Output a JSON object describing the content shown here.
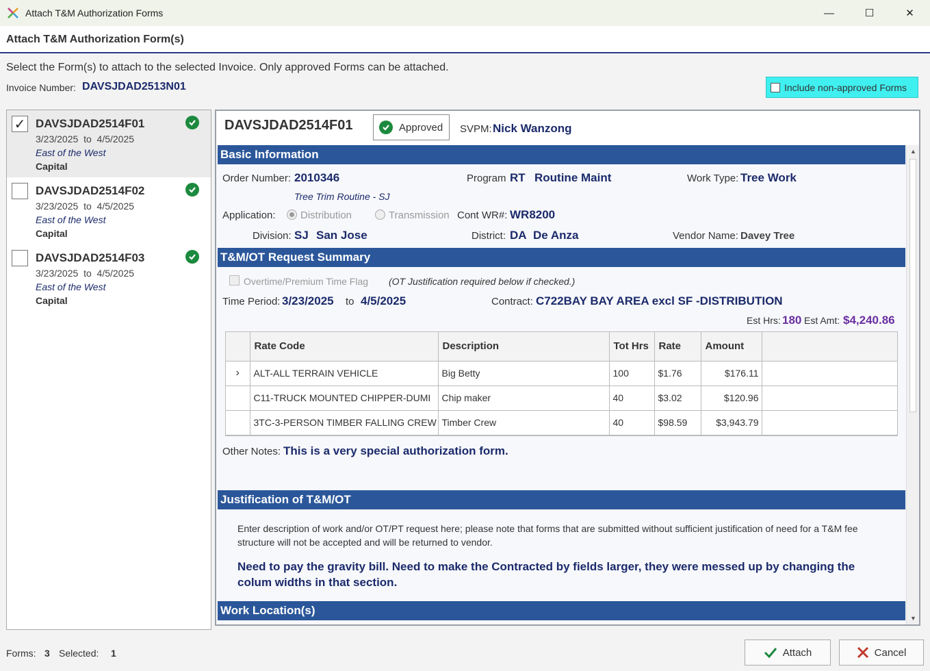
{
  "window": {
    "title": "Attach T&M Authorization Forms",
    "minimize_glyph": "—",
    "maximize_glyph": "☐",
    "close_glyph": "✕"
  },
  "header": {
    "title": "Attach T&M Authorization Form(s)"
  },
  "instructions": "Select the Form(s) to attach to the selected Invoice.  Only approved Forms can be attached.",
  "invoice": {
    "label": "Invoice Number:",
    "value": "DAVSJDAD2513N01"
  },
  "include_non_approved": {
    "label": "Include non-approved Forms",
    "checked": false
  },
  "forms": [
    {
      "id": "DAVSJDAD2514F01",
      "start": "3/23/2025",
      "to": "to",
      "end": "4/5/2025",
      "region": "East of the West",
      "type": "Capital",
      "checked": true,
      "status": "approved-icon"
    },
    {
      "id": "DAVSJDAD2514F02",
      "start": "3/23/2025",
      "to": "to",
      "end": "4/5/2025",
      "region": "East of the West",
      "type": "Capital",
      "checked": false,
      "status": "approved-icon"
    },
    {
      "id": "DAVSJDAD2514F03",
      "start": "3/23/2025",
      "to": "to",
      "end": "4/5/2025",
      "region": "East of the West",
      "type": "Capital",
      "checked": false,
      "status": "approved-icon"
    }
  ],
  "detail": {
    "form_id": "DAVSJDAD2514F01",
    "status": "Approved",
    "svpm_label": "SVPM:",
    "svpm_value": "Nick Wanzong",
    "sections": {
      "basic": "Basic Information",
      "summary": "T&M/OT Request Summary",
      "justification": "Justification of T&M/OT",
      "location": "Work Location(s)"
    },
    "basic": {
      "order_label": "Order Number:",
      "order_value": "2010346",
      "order_sub": "Tree Trim Routine - SJ",
      "program_label": "Program",
      "program_code": "RT",
      "program_name": "Routine Maint",
      "worktype_label": "Work Type:",
      "worktype_value": "Tree Work",
      "application_label": "Application:",
      "app_option1": "Distribution",
      "app_option2": "Transmission",
      "contwr_label": "Cont WR#:",
      "contwr_value": "WR8200",
      "division_label": "Division:",
      "division_code": "SJ",
      "division_name": "San Jose",
      "district_label": "District:",
      "district_code": "DA",
      "district_name": "De Anza",
      "vendor_label": "Vendor Name:",
      "vendor_value": "Davey Tree"
    },
    "summary": {
      "ot_flag_label": "Overtime/Premium Time Flag",
      "ot_note": "(OT Justification required below if checked.)",
      "time_label": "Time Period:",
      "time_start": "3/23/2025",
      "time_to": "to",
      "time_end": "4/5/2025",
      "contract_label": "Contract:",
      "contract_value": "C722BAY BAY AREA excl SF -DISTRIBUTION",
      "esthrs_label": "Est Hrs:",
      "esthrs_value": "180",
      "estamt_label": "Est Amt:",
      "estamt_value": "$4,240.86",
      "notes_label": "Other Notes:",
      "notes_value": "This is a very special authorization form."
    },
    "table": {
      "columns": [
        "Rate Code",
        "Description",
        "Tot Hrs",
        "Rate",
        "Amount"
      ],
      "rows": [
        {
          "code": "ALT-ALL TERRAIN VEHICLE",
          "desc": "Big Betty",
          "hrs": "100",
          "rate": "$1.76",
          "amount": "$176.11",
          "current": true
        },
        {
          "code": "C11-TRUCK MOUNTED CHIPPER-DUMI",
          "desc": "Chip maker",
          "hrs": "40",
          "rate": "$3.02",
          "amount": "$120.96",
          "current": false
        },
        {
          "code": "3TC-3-PERSON TIMBER FALLING CREW",
          "desc": "Timber Crew",
          "hrs": "40",
          "rate": "$98.59",
          "amount": "$3,943.79",
          "current": false
        }
      ]
    },
    "justification": {
      "prompt": "Enter description of work and/or OT/PT request here; please note that forms that are submitted without sufficient justification of need for a T&M fee structure will not be accepted and will be returned to vendor.",
      "text": "Need to pay the gravity bill.  Need to make the Contracted by fields larger, they were messed up by changing the colum widths in that section."
    }
  },
  "footer": {
    "forms_label": "Forms:",
    "forms_count": "3",
    "selected_label": "Selected:",
    "selected_count": "1",
    "attach_label": "Attach",
    "cancel_label": "Cancel"
  },
  "colors": {
    "accent": "#2b579a",
    "value_text": "#1b2a6b",
    "approved": "#1c8a3e",
    "highlight": "#40f0f0",
    "estimate": "#6b2fa0"
  }
}
